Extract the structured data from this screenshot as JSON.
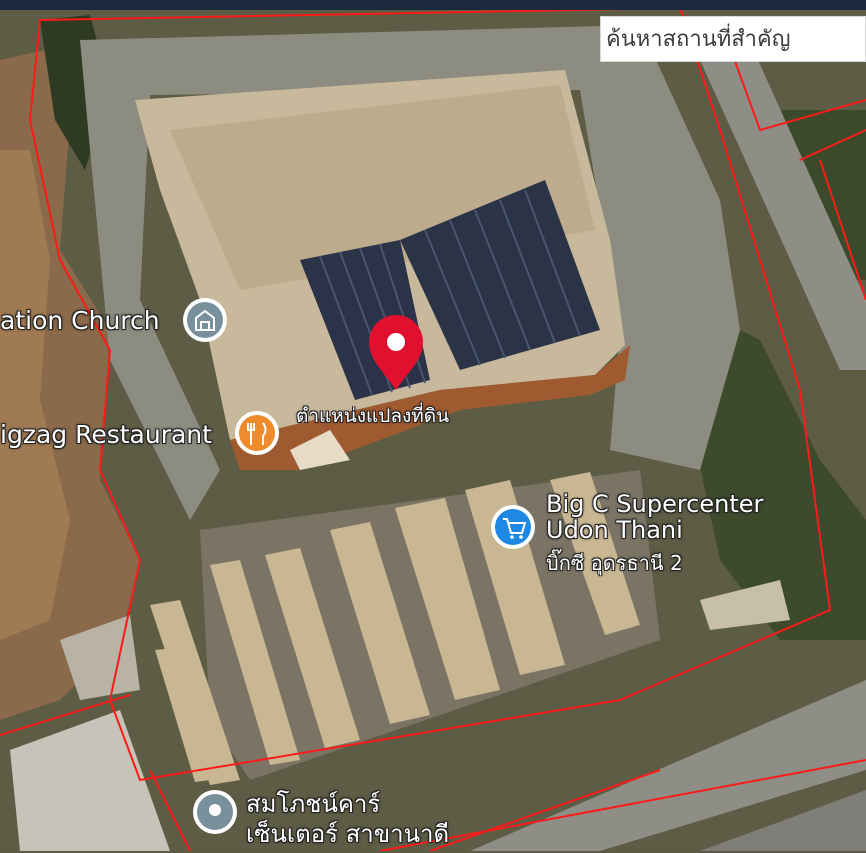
{
  "search": {
    "placeholder": "ค้นหาสถานที่สำคัญ"
  },
  "pois": {
    "church": {
      "label": "ation Church",
      "icon": "church-icon",
      "color": "#78909c"
    },
    "restaurant": {
      "label": "igzag Restaurant",
      "icon": "restaurant-icon",
      "color": "#ef8a2d"
    },
    "bigc": {
      "label_line1": "Big C Supercenter",
      "label_line2": "Udon Thani",
      "label_line3": "บิ๊กซี อุดรธานี 2",
      "icon": "shopping-cart-icon",
      "color": "#1e88e5"
    },
    "sammok": {
      "label_line1": "สมโภชน์คาร์",
      "label_line2": "เซ็นเตอร์ สาขานาดี",
      "icon": "place-icon",
      "color": "#78909c"
    }
  },
  "marker": {
    "label": "ตำแหน่งแปลงที่ดิน",
    "icon": "location-pin-icon",
    "color": "#e0102e"
  },
  "boundary_color": "#ff1a1a"
}
